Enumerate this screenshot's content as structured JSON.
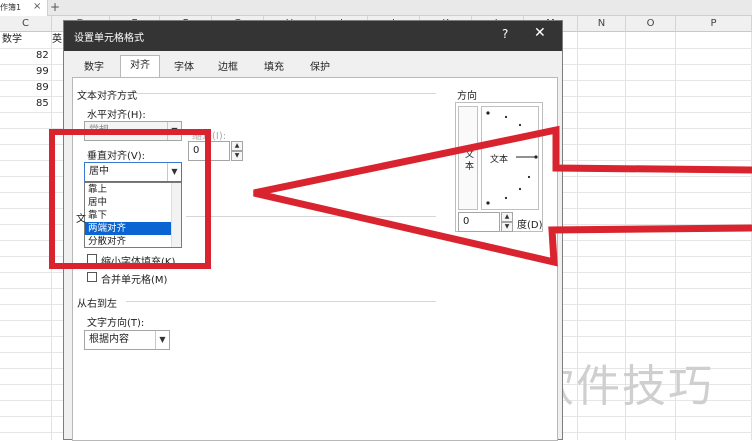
{
  "window": {
    "tab_title": "作簿1",
    "tab_close": "×",
    "tab_add": "+"
  },
  "sheet": {
    "columns": [
      "C",
      "D",
      "E",
      "F",
      "G",
      "H",
      "I",
      "J",
      "K",
      "L",
      "M",
      "N",
      "O",
      "P"
    ],
    "c_header_cell": "数学",
    "d_header_cell": "英",
    "c_values": [
      "82",
      "99",
      "89",
      "85"
    ]
  },
  "dialog": {
    "title": "设置单元格格式",
    "help": "?",
    "close": "✕",
    "tabs": [
      "数字",
      "对齐",
      "字体",
      "边框",
      "填充",
      "保护"
    ],
    "active_tab": "对齐",
    "text_alignment_title": "文本对齐方式",
    "horizontal_label": "水平对齐(H):",
    "horizontal_value": "常规",
    "indent_label": "缩进(I):",
    "vertical_label": "垂直对齐(V):",
    "vertical_value": "居中",
    "indent_value": "0",
    "vertical_options": [
      "靠上",
      "居中",
      "靠下",
      "两端对齐",
      "分散对齐"
    ],
    "vertical_selected": "两端对齐",
    "text_control_title": "文",
    "shrink_label": "缩小字体填充(K)",
    "merge_label": "合并单元格(M)",
    "rtl_title": "从右到左",
    "text_direction_label": "文字方向(T):",
    "text_direction_value": "根据内容",
    "orientation_title": "方向",
    "orientation_vertical_text": "文本",
    "orientation_text": "文本",
    "degrees_value": "0",
    "degrees_label": "度(D)"
  },
  "watermark": "软件技巧",
  "annotation_color": "#d9232e"
}
